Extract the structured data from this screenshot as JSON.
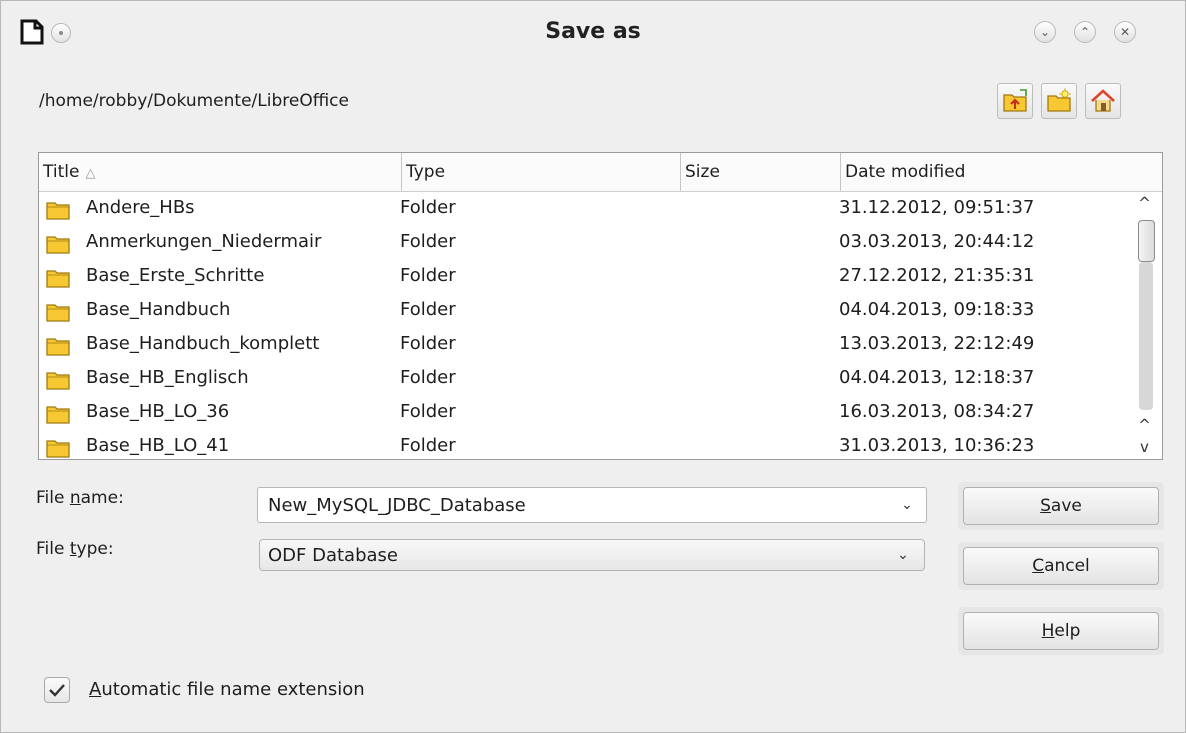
{
  "window": {
    "title": "Save as",
    "minimize_glyph": "⌄",
    "maximize_glyph": "⌃",
    "close_glyph": "✕"
  },
  "path": "/home/robby/Dokumente/LibreOffice",
  "toolbar": {
    "icons": [
      "folder-up-icon",
      "new-folder-icon",
      "home-icon"
    ]
  },
  "file_list": {
    "columns": [
      "Title",
      "Type",
      "Size",
      "Date modified"
    ],
    "sort_indicator": "△",
    "rows": [
      {
        "title": "Andere_HBs",
        "type": "Folder",
        "size": "",
        "date": "31.12.2012, 09:51:37"
      },
      {
        "title": "Anmerkungen_Niedermair",
        "type": "Folder",
        "size": "",
        "date": "03.03.2013, 20:44:12"
      },
      {
        "title": "Base_Erste_Schritte",
        "type": "Folder",
        "size": "",
        "date": "27.12.2012, 21:35:31"
      },
      {
        "title": "Base_Handbuch",
        "type": "Folder",
        "size": "",
        "date": "04.04.2013, 09:18:33"
      },
      {
        "title": "Base_Handbuch_komplett",
        "type": "Folder",
        "size": "",
        "date": "13.03.2013, 22:12:49"
      },
      {
        "title": "Base_HB_Englisch",
        "type": "Folder",
        "size": "",
        "date": "04.04.2013, 12:18:37"
      },
      {
        "title": "Base_HB_LO_36",
        "type": "Folder",
        "size": "",
        "date": "16.03.2013, 08:34:27"
      },
      {
        "title": "Base_HB_LO_41",
        "type": "Folder",
        "size": "",
        "date": "31.03.2013, 10:36:23"
      }
    ],
    "scroll": {
      "up_glyph": "^",
      "down_glyph": "v"
    }
  },
  "form": {
    "file_name_label_pre": "File ",
    "file_name_label_ul": "n",
    "file_name_label_post": "ame:",
    "file_name_value": "New_MySQL_JDBC_Database",
    "file_type_label_pre": "File ",
    "file_type_label_ul": "t",
    "file_type_label_post": "ype:",
    "file_type_value": "ODF Database",
    "chevron": "⌄"
  },
  "buttons": {
    "save_ul": "S",
    "save_rest": "ave",
    "cancel_ul": "C",
    "cancel_rest": "ancel",
    "help_ul": "H",
    "help_rest": "elp"
  },
  "auto_extension": {
    "checked": true,
    "label_ul": "A",
    "label_rest": "utomatic file name extension"
  },
  "colors": {
    "folder_fill": "#f7c832",
    "folder_stroke": "#a07a12",
    "home_roof": "#e0442a"
  }
}
